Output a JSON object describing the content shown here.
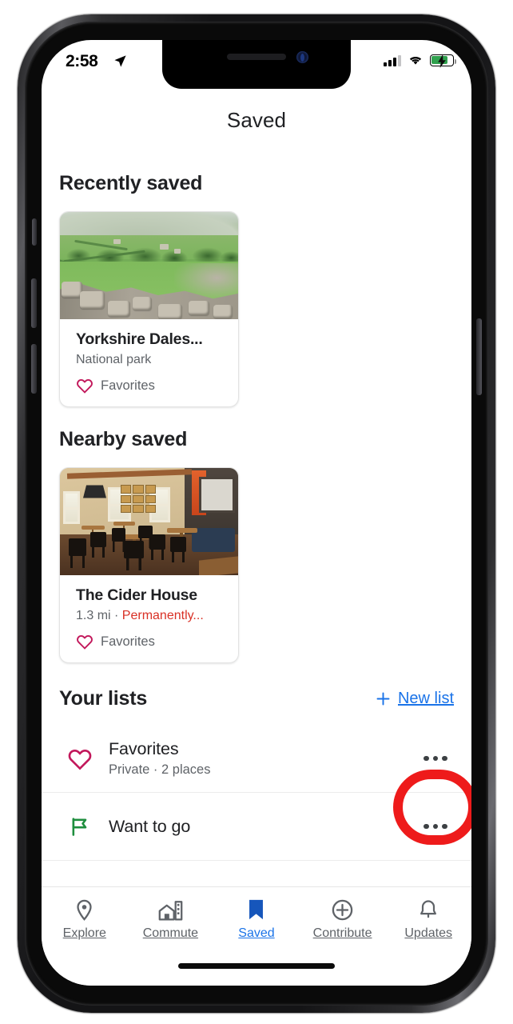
{
  "status_bar": {
    "time": "2:58",
    "location_icon": "location-arrow-icon",
    "signal_icon": "cellular-signal-icon",
    "wifi_icon": "wifi-icon",
    "battery_icon": "battery-charging-icon"
  },
  "header": {
    "title": "Saved"
  },
  "sections": {
    "recently_saved": {
      "title": "Recently saved",
      "card": {
        "name": "Yorkshire Dales...",
        "subtitle": "National park",
        "list_label": "Favorites",
        "list_icon": "heart-icon",
        "photo": "yorkshire-dales-landscape-photo"
      }
    },
    "nearby_saved": {
      "title": "Nearby saved",
      "card": {
        "name": "The Cider House",
        "distance": "1.3 mi · ",
        "status": "Permanently...",
        "list_label": "Favorites",
        "list_icon": "heart-icon",
        "photo": "cider-house-interior-photo"
      }
    },
    "your_lists": {
      "title": "Your lists",
      "new_list_label": "New list",
      "new_list_icon": "plus-icon",
      "items": [
        {
          "name": "Favorites",
          "subtitle": "Private · 2 places",
          "icon": "heart-icon",
          "more_icon": "more-options-icon"
        },
        {
          "name": "Want to go",
          "subtitle": "",
          "icon": "flag-icon",
          "more_icon": "more-options-icon"
        }
      ]
    }
  },
  "tab_bar": {
    "tabs": [
      {
        "label": "Explore",
        "icon": "map-pin-icon",
        "active": false
      },
      {
        "label": "Commute",
        "icon": "buildings-icon",
        "active": false
      },
      {
        "label": "Saved",
        "icon": "bookmark-icon",
        "active": true
      },
      {
        "label": "Contribute",
        "icon": "plus-circle-icon",
        "active": false
      },
      {
        "label": "Updates",
        "icon": "bell-icon",
        "active": false
      }
    ]
  },
  "annotation": {
    "shape": "red-circle-highlight",
    "target": "favorites-more-options-button"
  },
  "colors": {
    "accent_blue": "#1a73e8",
    "heart_pink": "#c2185b",
    "flag_green": "#1e8e3e",
    "warning_red": "#d93025",
    "annotation_red": "#ee1b1b",
    "text_primary": "#202124",
    "text_secondary": "#5f6368"
  }
}
